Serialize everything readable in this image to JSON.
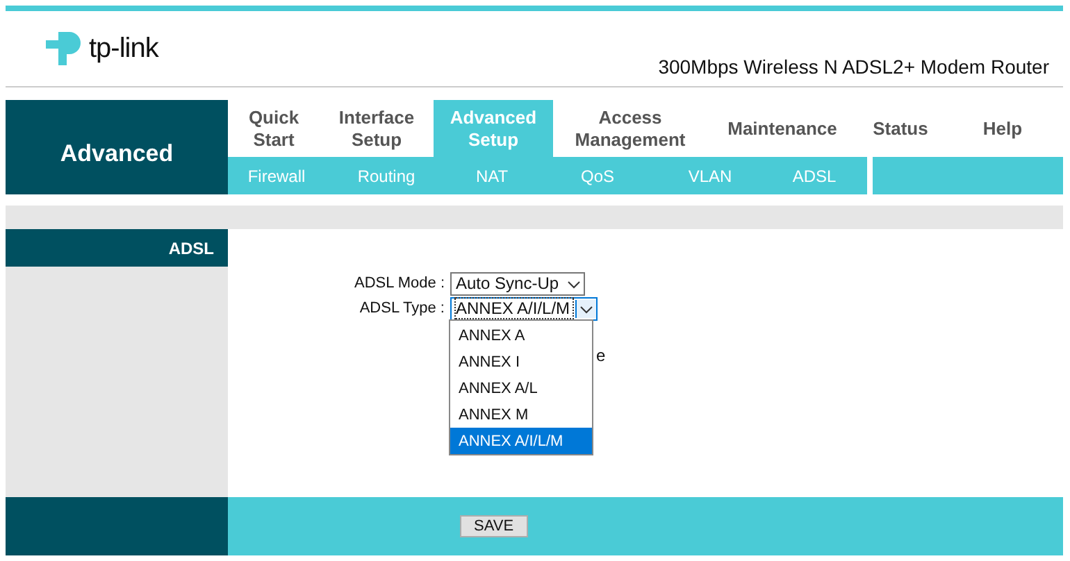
{
  "header": {
    "logo_text": "tp-link",
    "product": "300Mbps Wireless N ADSL2+ Modem Router"
  },
  "section": "Advanced",
  "menu": [
    {
      "label": "Quick Start",
      "selected": false
    },
    {
      "label": "Interface Setup",
      "selected": false
    },
    {
      "label": "Advanced Setup",
      "selected": true
    },
    {
      "label": "Access Management",
      "selected": false
    },
    {
      "label": "Maintenance",
      "selected": false
    },
    {
      "label": "Status",
      "selected": false
    },
    {
      "label": "Help",
      "selected": false
    }
  ],
  "submenu": [
    {
      "label": "Firewall",
      "selected": false
    },
    {
      "label": "Routing",
      "selected": false
    },
    {
      "label": "NAT",
      "selected": false
    },
    {
      "label": "QoS",
      "selected": false
    },
    {
      "label": "VLAN",
      "selected": false
    },
    {
      "label": "ADSL",
      "selected": false
    }
  ],
  "side_label": "ADSL",
  "fields": [
    {
      "label": "ADSL Mode :",
      "value": "Auto Sync-Up",
      "open": false
    },
    {
      "label": "ADSL Type :",
      "value": "ANNEX A/I/L/M",
      "open": true
    }
  ],
  "covered_text_tail": "e",
  "dropdown_options": [
    {
      "label": "ANNEX A",
      "selected": false
    },
    {
      "label": "ANNEX I",
      "selected": false
    },
    {
      "label": "ANNEX A/L",
      "selected": false
    },
    {
      "label": "ANNEX M",
      "selected": false
    },
    {
      "label": "ANNEX A/I/L/M",
      "selected": true
    }
  ],
  "save_button": "SAVE"
}
